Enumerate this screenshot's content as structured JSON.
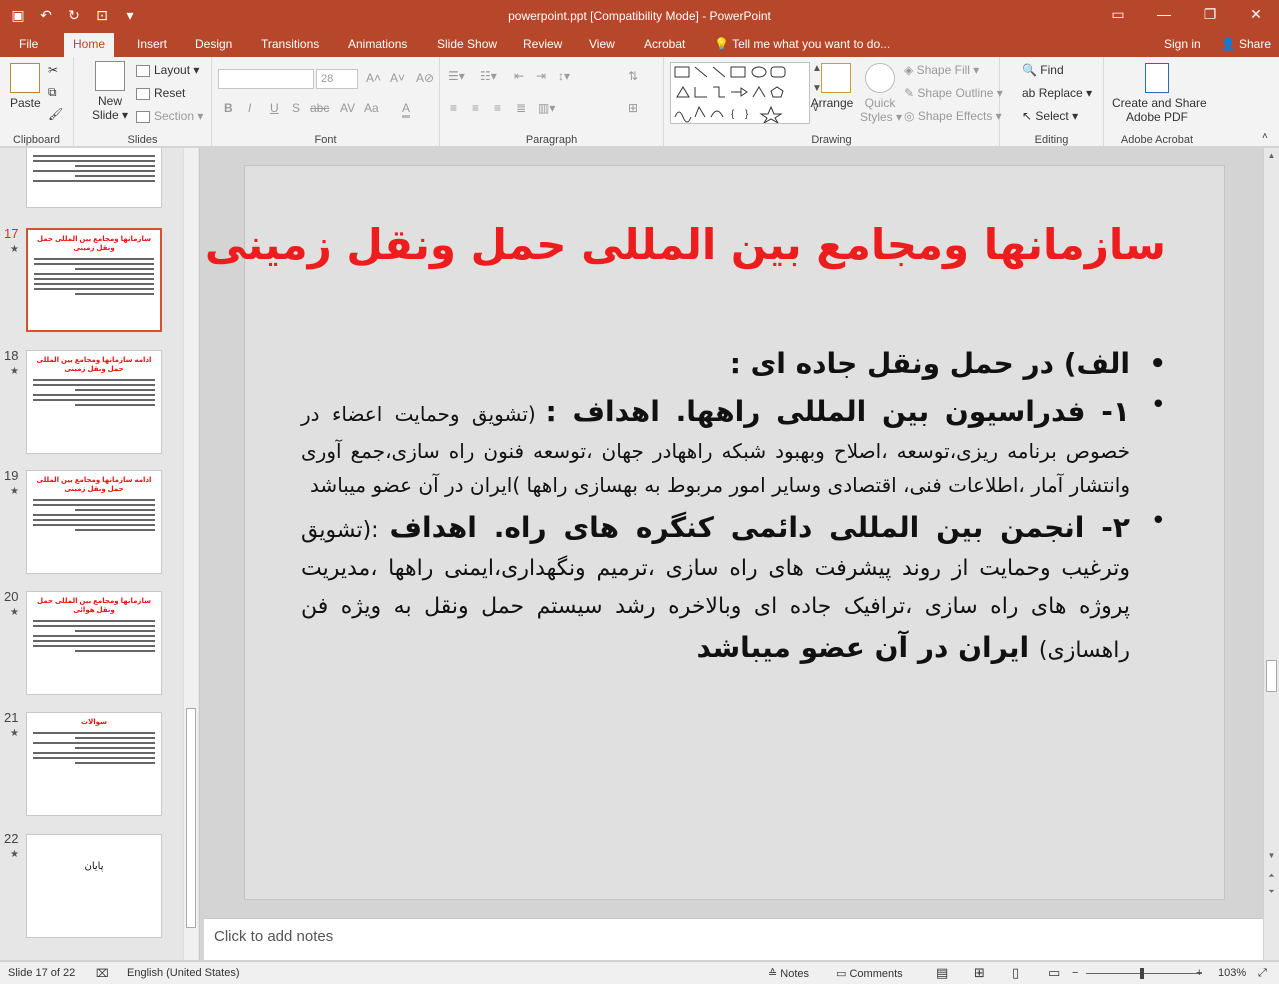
{
  "window": {
    "title": "powerpoint.ppt [Compatibility Mode] - PowerPoint",
    "qat_icons": [
      "save-icon",
      "undo-icon",
      "redo-icon",
      "start-from-beginning-icon",
      "customize-qat-icon"
    ],
    "controls": [
      "▭",
      "—",
      "❐",
      "✕"
    ]
  },
  "tabs": [
    "File",
    "Home",
    "Insert",
    "Design",
    "Transitions",
    "Animations",
    "Slide Show",
    "Review",
    "View",
    "Acrobat",
    "Tell me what you want to do..."
  ],
  "active_tab": "Home",
  "account": {
    "signin": "Sign in",
    "share": "Share"
  },
  "ribbon": {
    "clipboard": {
      "label": "Clipboard",
      "paste": "Paste"
    },
    "slides": {
      "label": "Slides",
      "new_slide": "New",
      "new_slide2": "Slide",
      "layout": "Layout",
      "reset": "Reset",
      "section": "Section"
    },
    "font": {
      "label": "Font",
      "size": "28",
      "buttons": [
        "B",
        "I",
        "U",
        "S",
        "abc",
        "AV",
        "Aa",
        "A"
      ]
    },
    "paragraph": {
      "label": "Paragraph"
    },
    "drawing": {
      "label": "Drawing",
      "arrange": "Arrange",
      "quick_styles": "Quick",
      "quick_styles2": "Styles",
      "shape_fill": "Shape Fill",
      "shape_outline": "Shape Outline",
      "shape_effects": "Shape Effects"
    },
    "editing": {
      "label": "Editing",
      "find": "Find",
      "replace": "Replace",
      "select": "Select"
    },
    "acrobat": {
      "label": "Adobe Acrobat",
      "create": "Create and Share",
      "create2": "Adobe PDF"
    }
  },
  "thumbnails": [
    {
      "num": "",
      "title": "",
      "active": false
    },
    {
      "num": "17",
      "title": "سازمانها ومجامع بین المللی حمل ونقل زمینی",
      "active": true
    },
    {
      "num": "18",
      "title": "ادامه سازمانها ومجامع بین المللی حمل ونقل زمینی",
      "active": false
    },
    {
      "num": "19",
      "title": "ادامه سازمانها ومجامع بین المللی حمل ونقل زمینی",
      "active": false
    },
    {
      "num": "20",
      "title": "سازمانها ومجامع بین المللی حمل ونقل هوائی",
      "active": false
    },
    {
      "num": "21",
      "title": "سوالات",
      "active": false
    },
    {
      "num": "22",
      "title": "پایان",
      "active": false
    }
  ],
  "slide": {
    "title": "سازمانها ومجامع بین المللی حمل ونقل زمینی",
    "bullets": [
      {
        "text": "الف) در حمل ونقل جاده ای :"
      },
      {
        "heading": "۱- فدراسیون بین المللی راهها. اهداف :",
        "body": "(تشویق وحمایت اعضاء در خصوص برنامه ریزی،توسعه ،اصلاح وبهبود شبکه راههادر جهان ،توسعه فنون راه سازی،جمع آوری وانتشار آمار ،اطلاعات فنی، اقتصادی وسایر امور مربوط به بهسازی راهها )ایران در آن عضو میباشد"
      },
      {
        "heading": "۲- انجمن بین المللی دائمی کنگره های راه. اهداف",
        "body": ":(تشویق وترغیب وحمایت از روند پیشرفت های راه سازی ،ترمیم ونگهداری،ایمنی راهها ،مدیریت پروژه های راه سازی ،ترافیک جاده ای وبالاخره رشد سیستم حمل ونقل به ویژه فن راهسازی)",
        "tail": " ایران در آن عضو میباشد"
      }
    ]
  },
  "notes": {
    "placeholder": "Click to add notes"
  },
  "status": {
    "slide": "Slide 17 of 22",
    "language": "English (United States)",
    "notes": "Notes",
    "comments": "Comments",
    "zoom": "103%"
  }
}
